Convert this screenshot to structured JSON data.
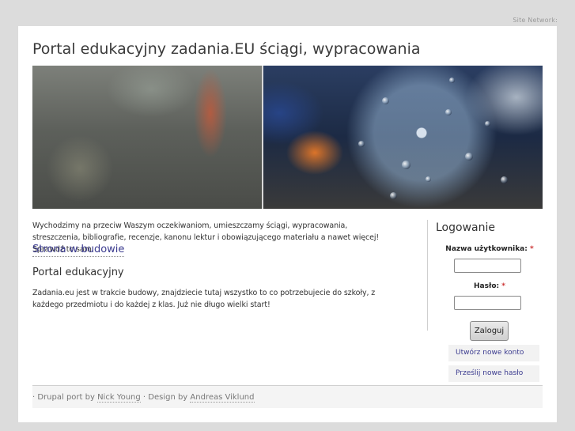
{
  "top": {
    "site_network": "Site Network:"
  },
  "header": {
    "title": "Portal edukacyjny zadania.EU ściągi, wypracowania"
  },
  "main": {
    "intro": "Wychodzimy na przeciw Waszym oczekiwaniom, umieszczamy ściągi, wypracowania, streszczenia, bibliografie, recenzje, kanonu lektur i obowiązującego materiału a nawet więcej! Sprawdź to sam.",
    "link": "Strona w budowie",
    "heading": "Portal edukacyjny",
    "body": "Zadania.eu jest w trakcie budowy, znajdziecie tutaj wszystko to co potrzebujecie do szkoły, z każdego przedmiotu i do każdej z klas. Już nie długo wielki start!"
  },
  "login": {
    "title": "Logowanie",
    "username_label": "Nazwa użytkownika:",
    "password_label": "Hasło:",
    "required_mark": "*",
    "username_value": "",
    "password_value": "",
    "submit": "Zaloguj",
    "create_account": "Utwórz nowe konto",
    "reset_password": "Prześlij nowe hasło"
  },
  "footer": {
    "prefix": "· Drupal port by ",
    "drupal_author": "Nick Young",
    "separator": " · Design by ",
    "design_author": "Andreas Viklund"
  }
}
